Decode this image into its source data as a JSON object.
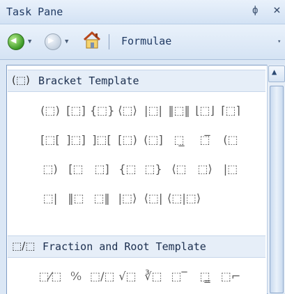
{
  "title_bar": {
    "title": "Task Pane",
    "pin_glyph": "ф",
    "close_glyph": "×"
  },
  "toolbar": {
    "back_icon": "back-arrow-icon",
    "forward_icon": "forward-arrow-icon",
    "home_icon": "home-icon",
    "label": "Formulae",
    "dropdown_glyph": "▾"
  },
  "sections": [
    {
      "title": "Bracket Template",
      "icon_glyph": "(⬚)",
      "rows": [
        [
          "(⬚)",
          "[⬚]",
          "{⬚}",
          "⟨⬚⟩",
          "|⬚|",
          "‖⬚‖",
          "⌊⬚⌋",
          "⌈⬚⌉"
        ],
        [
          "[⬚[",
          "]⬚]",
          "]⬚[",
          "[⬚)",
          "(⬚]",
          "⬚̲",
          "⬚̅",
          "(⬚"
        ],
        [
          "⬚)",
          "[⬚",
          "⬚]",
          "{⬚",
          "⬚}",
          "⟨⬚",
          "⬚⟩",
          "|⬚"
        ],
        [
          "⬚|",
          "‖⬚",
          "⬚‖",
          "|⬚⟩",
          "⟨⬚|",
          "⟨⬚|⬚⟩"
        ]
      ]
    },
    {
      "title": "Fraction and Root Template",
      "icon_glyph": "⬚/⬚",
      "rows": [
        [
          "⬚⁄⬚",
          "⁰⁄₀",
          "⬚/⬚",
          "√⬚",
          "∛⬚",
          "⬚‾",
          "⬚̳",
          "⬚⌐"
        ]
      ]
    }
  ]
}
